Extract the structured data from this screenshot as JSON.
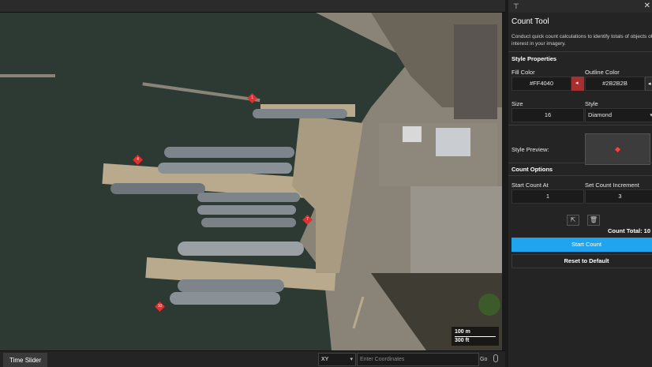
{
  "panel": {
    "title": "Count Tool",
    "description": "Conduct quick count calculations to identify totals of objects of interest in your imagery.",
    "style_section": "Style Properties",
    "fill_color_label": "Fill Color",
    "fill_color_value": "#FF4040",
    "outline_color_label": "Outline Color",
    "outline_color_value": "#2B2B2B",
    "size_label": "Size",
    "size_value": "16",
    "style_label": "Style",
    "style_value": "Diamond",
    "preview_label": "Style Preview:",
    "count_section": "Count Options",
    "start_at_label": "Start Count At",
    "start_at_value": "1",
    "increment_label": "Set Count Increment",
    "increment_value": "3",
    "count_total": "Count Total: 10",
    "start_button": "Start Count",
    "reset_button": "Reset to Default"
  },
  "bottom": {
    "time_slider": "Time Slider",
    "coord_system": "XY",
    "coord_placeholder": "Enter Coordinates",
    "go": "Go"
  },
  "map": {
    "scale_m": "100 m",
    "scale_ft": "300 ft",
    "markers": [
      "1",
      "4",
      "7",
      "10"
    ]
  },
  "colors": {
    "fill": "#FF4040",
    "outline": "#2B2B2B",
    "accent": "#21A4F0"
  },
  "icons": [
    "pin-icon",
    "close-icon",
    "chevron-down-icon",
    "color-picker-icon",
    "export-icon",
    "trash-icon",
    "microphone-icon"
  ]
}
